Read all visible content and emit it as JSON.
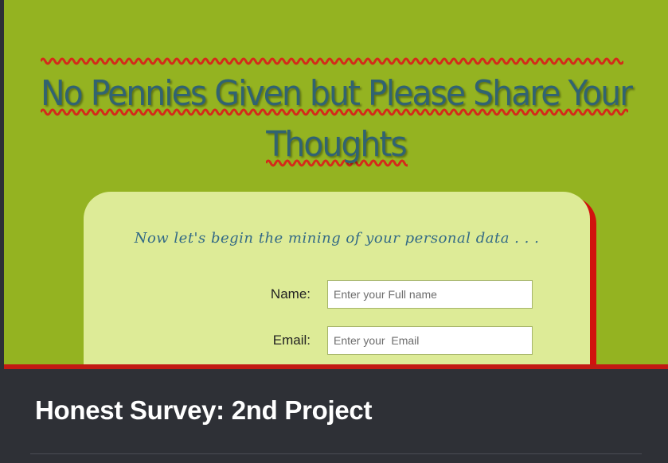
{
  "preview": {
    "headline_line1": "No Pennies Given but Please Share Your",
    "headline_line2": "Thoughts",
    "tagline": "Now let's begin the mining of your personal data . . .",
    "form": {
      "name_label": "Name:",
      "name_placeholder": "Enter your Full name",
      "email_label": "Email:",
      "email_placeholder": "Enter your  Email"
    }
  },
  "footer": {
    "title": "Honest Survey: 2nd Project"
  },
  "colors": {
    "preview_background": "#94b321",
    "headline": "#316371",
    "card": "#ddeb97",
    "card_shadow": "#d1120e",
    "spellcheck_underline": "#d42a1a",
    "footer_background": "#2e3036"
  }
}
